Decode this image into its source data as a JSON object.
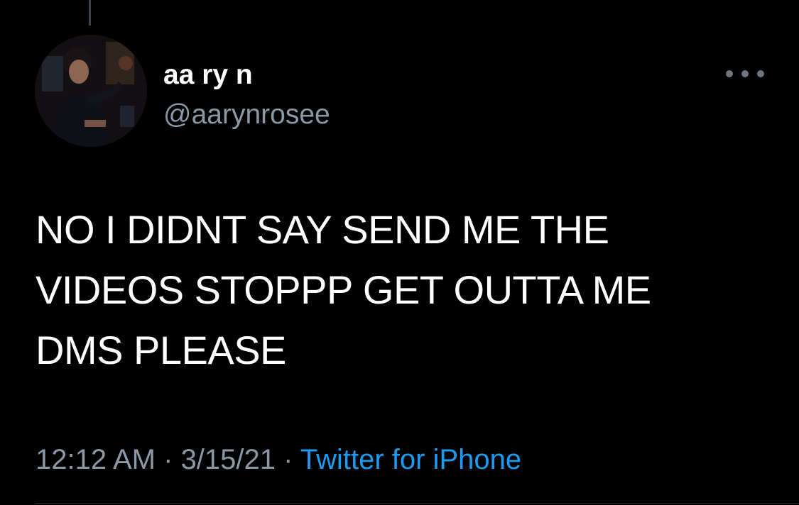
{
  "user": {
    "display_name": "aa ry n",
    "handle": "@aarynrosee",
    "avatar_icon": "user-avatar"
  },
  "tweet": {
    "text_lines": [
      "NO I DIDNT SAY SEND ME THE",
      "VIDEOS STOPPP GET OUTTA ME",
      "DMS PLEASE"
    ]
  },
  "meta": {
    "time": "12:12 AM",
    "separator": " · ",
    "date": "3/15/21",
    "source": "Twitter for iPhone"
  },
  "actions": {
    "more_icon": "more-horizontal-icon"
  },
  "colors": {
    "background": "#000000",
    "primary_text": "#ffffff",
    "secondary_text": "#8b98a5",
    "link": "#1d9bf0",
    "divider": "#2f3336"
  }
}
